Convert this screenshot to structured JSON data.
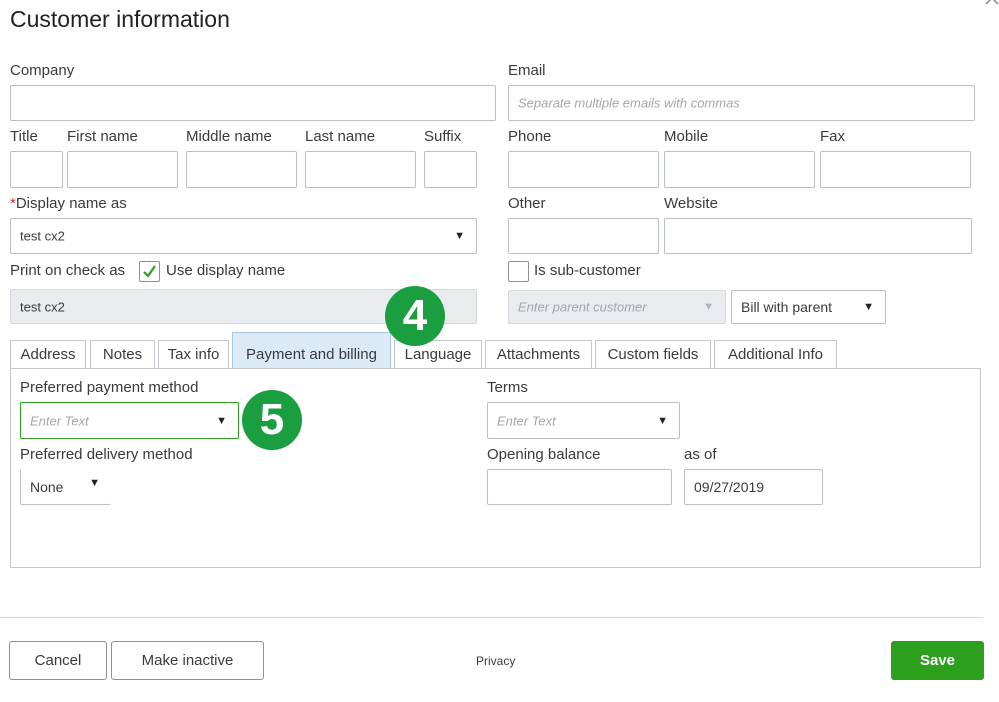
{
  "dialog": {
    "title": "Customer information"
  },
  "fields": {
    "company": {
      "label": "Company",
      "value": ""
    },
    "email": {
      "label": "Email",
      "placeholder": "Separate multiple emails with commas"
    },
    "title": {
      "label": "Title"
    },
    "first_name": {
      "label": "First name"
    },
    "middle_name": {
      "label": "Middle name"
    },
    "last_name": {
      "label": "Last name"
    },
    "suffix": {
      "label": "Suffix"
    },
    "phone": {
      "label": "Phone"
    },
    "mobile": {
      "label": "Mobile"
    },
    "fax": {
      "label": "Fax"
    },
    "display_name": {
      "required_mark": "*",
      "label": "Display name as",
      "value": "test cx2"
    },
    "other": {
      "label": "Other"
    },
    "website": {
      "label": "Website"
    },
    "print_on_check": {
      "label": "Print on check as",
      "use_display_label": "Use display name",
      "checked": true,
      "value": "test cx2"
    },
    "sub_customer": {
      "label": "Is sub-customer",
      "checked": false
    },
    "parent_customer": {
      "placeholder": "Enter parent customer"
    },
    "bill_with_parent": {
      "value": "Bill with parent"
    }
  },
  "tabs": [
    {
      "label": "Address",
      "active": false
    },
    {
      "label": "Notes",
      "active": false
    },
    {
      "label": "Tax info",
      "active": false
    },
    {
      "label": "Payment and billing",
      "active": true
    },
    {
      "label": "Language",
      "active": false
    },
    {
      "label": "Attachments",
      "active": false
    },
    {
      "label": "Custom fields",
      "active": false
    },
    {
      "label": "Additional Info",
      "active": false
    }
  ],
  "payment": {
    "preferred_method": {
      "label": "Preferred payment method",
      "placeholder": "Enter Text"
    },
    "preferred_delivery": {
      "label": "Preferred delivery method",
      "value": "None"
    },
    "terms": {
      "label": "Terms",
      "placeholder": "Enter Text"
    },
    "opening_balance": {
      "label": "Opening balance",
      "value": ""
    },
    "as_of": {
      "label": "as of",
      "value": "09/27/2019"
    }
  },
  "annotations": {
    "step4": "4",
    "step5": "5"
  },
  "footer": {
    "cancel_label": "Cancel",
    "make_inactive_label": "Make inactive",
    "privacy_label": "Privacy",
    "save_label": "Save"
  },
  "icons": {
    "dropdown": "caret-down-icon",
    "check": "checkmark-icon",
    "close": "chevron-up-icon"
  },
  "colors": {
    "primary": "#2ca01c",
    "badge": "#1a9e3f",
    "active_tab": "#daeaf7",
    "required": "#d52b1e",
    "focus": "#2ca01c"
  }
}
